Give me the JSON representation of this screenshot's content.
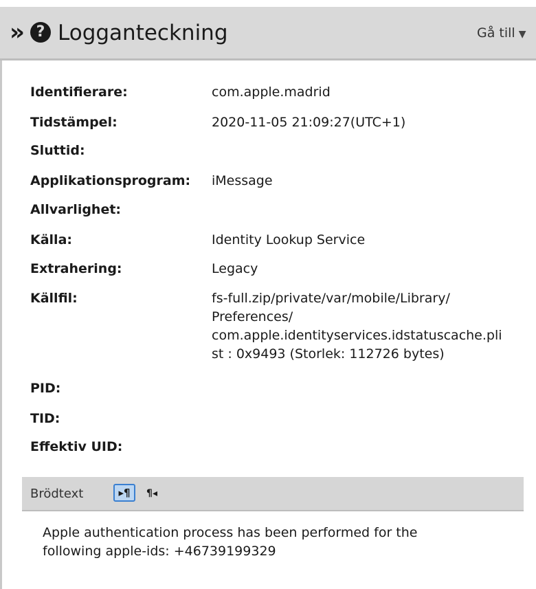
{
  "header": {
    "title": "Logganteckning",
    "goto_label": "Gå till",
    "collapse_glyph": "»",
    "help_glyph": "?",
    "caret_glyph": "▼"
  },
  "fields": [
    {
      "label": "Identifierare:",
      "value": "com.apple.madrid"
    },
    {
      "label": "Tidstämpel:",
      "value": "2020-11-05 21:09:27(UTC+1)"
    },
    {
      "label": "Sluttid:",
      "value": ""
    },
    {
      "label": "Applikationsprogram:",
      "value": "iMessage"
    },
    {
      "label": "Allvarlighet:",
      "value": ""
    },
    {
      "label": "Källa:",
      "value": "Identity Lookup Service"
    },
    {
      "label": "Extrahering:",
      "value": "Legacy"
    },
    {
      "label": "Källfil:",
      "value_lines": [
        "fs-full.zip/private/var/mobile/Library/",
        "Preferences/",
        "com.apple.identityservices.idstatuscache.pli",
        "st : 0x9493 (Storlek: 112726 bytes)"
      ]
    },
    {
      "label": "PID:",
      "value": ""
    },
    {
      "label": "TID:",
      "value": ""
    },
    {
      "label": "Effektiv UID:",
      "value": ""
    }
  ],
  "body_section": {
    "label": "Brödtext",
    "ltr_glyph": "▸¶",
    "rtl_glyph": "¶◂",
    "text_lines": [
      "Apple authentication process has been performed for the",
      "following apple-ids: +46739199329"
    ]
  }
}
